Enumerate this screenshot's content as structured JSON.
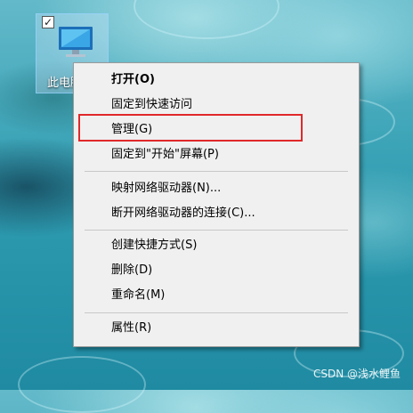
{
  "desktop": {
    "icon_label": "此电脑",
    "icon_checkbox": "✓"
  },
  "context_menu": {
    "items": [
      {
        "label": "打开(O)"
      },
      {
        "label": "固定到快速访问"
      },
      {
        "label": "管理(G)"
      },
      {
        "label": "固定到\"开始\"屏幕(P)"
      },
      {
        "label": "映射网络驱动器(N)..."
      },
      {
        "label": "断开网络驱动器的连接(C)..."
      },
      {
        "label": "创建快捷方式(S)"
      },
      {
        "label": "删除(D)"
      },
      {
        "label": "重命名(M)"
      },
      {
        "label": "属性(R)"
      }
    ]
  },
  "highlight": {
    "target": "管理(G)",
    "color": "#e0282a"
  },
  "watermark": "CSDN @浅水鲤鱼"
}
